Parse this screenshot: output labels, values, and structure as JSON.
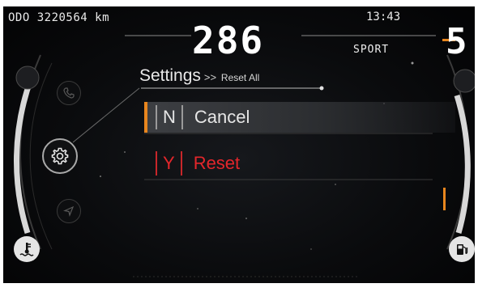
{
  "status": {
    "odometer": "ODO 3220564 km",
    "clock": "13:43",
    "speed": "286",
    "ride_mode": "SPORT",
    "gear": "5"
  },
  "menu": {
    "title": "Settings",
    "breadcrumb_sep": ">>",
    "breadcrumb": "Reset All",
    "options": [
      {
        "key": "N",
        "label": "Cancel",
        "selected": true
      },
      {
        "key": "Y",
        "label": "Reset",
        "selected": false
      }
    ]
  },
  "icons": {
    "left_menu": [
      "phone-icon",
      "settings-gear-icon",
      "navigation-icon"
    ],
    "bottom_left": "coolant-temperature-icon",
    "bottom_right": "fuel-pump-icon"
  },
  "colors": {
    "selection_accent": "#e8861e",
    "reset_red": "#e4262b",
    "background": "#0a0b0d"
  }
}
